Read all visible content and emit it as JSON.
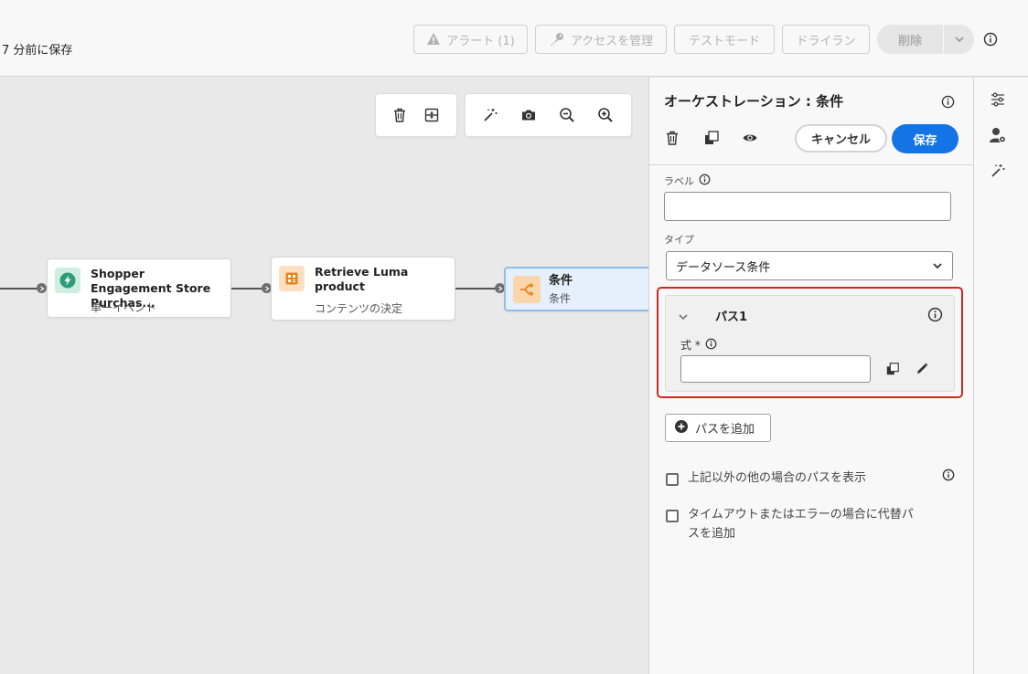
{
  "header": {
    "saved_text": "7 分前に保存",
    "buttons": {
      "alerts": "アラート (1)",
      "access": "アクセスを管理",
      "test_mode": "テストモード",
      "dry_run": "ドライラン",
      "delete": "削除"
    }
  },
  "canvas": {
    "nodes": [
      {
        "title": "Shopper Engagement Store Purchas...",
        "subtitle": "単一イベント"
      },
      {
        "title": "Retrieve Luma product",
        "subtitle": "コンテンツの決定"
      },
      {
        "title": "条件",
        "subtitle": "条件"
      }
    ]
  },
  "panel": {
    "title": "オーケストレーション : 条件",
    "cancel_label": "キャンセル",
    "save_label": "保存",
    "label_field": {
      "label": "ラベル",
      "value": ""
    },
    "type_field": {
      "label": "タイプ",
      "value": "データソース条件"
    },
    "path": {
      "title": "パス1",
      "expression_label": "式 *",
      "expression_value": ""
    },
    "add_path_label": "パスを追加",
    "checkbox_other": "上記以外の他の場合のパスを表示",
    "checkbox_timeout": "タイムアウトまたはエラーの場合に代替パスを追加"
  },
  "colors": {
    "accent": "#1473e6",
    "highlight": "#d7261e",
    "event_icon": "#2d9d78",
    "content_icon": "#e68619"
  }
}
